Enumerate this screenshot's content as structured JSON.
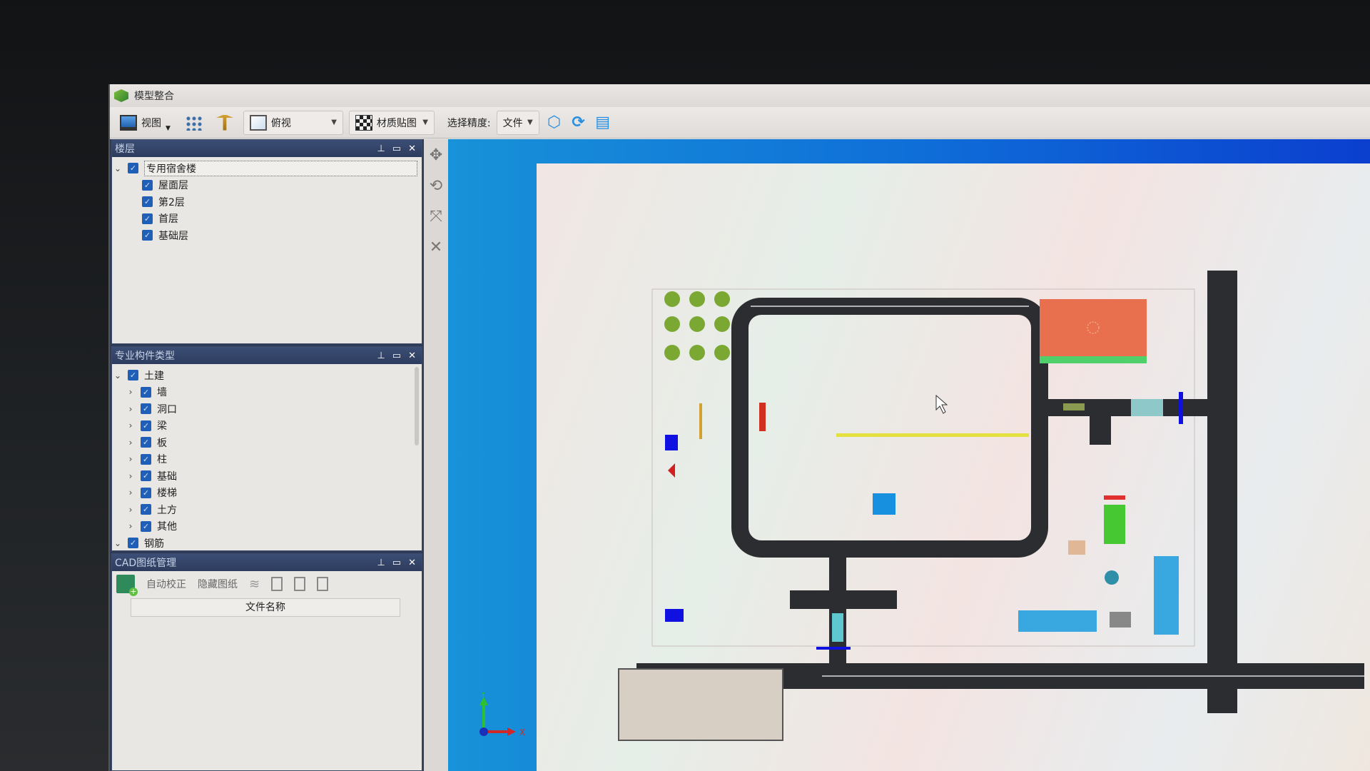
{
  "window": {
    "title": "模型整合"
  },
  "toolbar": {
    "view_label": "视图",
    "view_mode": "俯视",
    "material_label": "材质贴图",
    "precision_label": "选择精度:",
    "precision_value": "文件"
  },
  "floors_panel": {
    "title": "楼层",
    "root": {
      "label": "专用宿舍楼",
      "checked": true,
      "expanded": true
    },
    "items": [
      {
        "label": "屋面层",
        "checked": true
      },
      {
        "label": "第2层",
        "checked": true
      },
      {
        "label": "首层",
        "checked": true
      },
      {
        "label": "基础层",
        "checked": true
      }
    ]
  },
  "component_panel": {
    "title": "专业构件类型",
    "groups": [
      {
        "label": "土建",
        "checked": true,
        "expanded": true,
        "items": [
          {
            "label": "墙",
            "checked": true
          },
          {
            "label": "洞口",
            "checked": true
          },
          {
            "label": "梁",
            "checked": true
          },
          {
            "label": "板",
            "checked": true
          },
          {
            "label": "柱",
            "checked": true
          },
          {
            "label": "基础",
            "checked": true
          },
          {
            "label": "楼梯",
            "checked": true
          },
          {
            "label": "土方",
            "checked": true
          },
          {
            "label": "其他",
            "checked": true
          }
        ]
      },
      {
        "label": "钢筋",
        "checked": true,
        "expanded": true,
        "items": []
      }
    ]
  },
  "cad_panel": {
    "title": "CAD图纸管理",
    "auto_correct": "自动校正",
    "hide_drawing": "隐藏图纸",
    "column_header": "文件名称"
  },
  "viewport": {
    "axis_x": "X",
    "axis_y": "Y",
    "colors": {
      "road": "#2b2d30",
      "court": "#e8704e",
      "court_edge": "#4fd06a",
      "water": "#3aa8e0",
      "blue_block": "#1010e0",
      "lawn": "#46c832",
      "tree": "#7aa832"
    }
  }
}
